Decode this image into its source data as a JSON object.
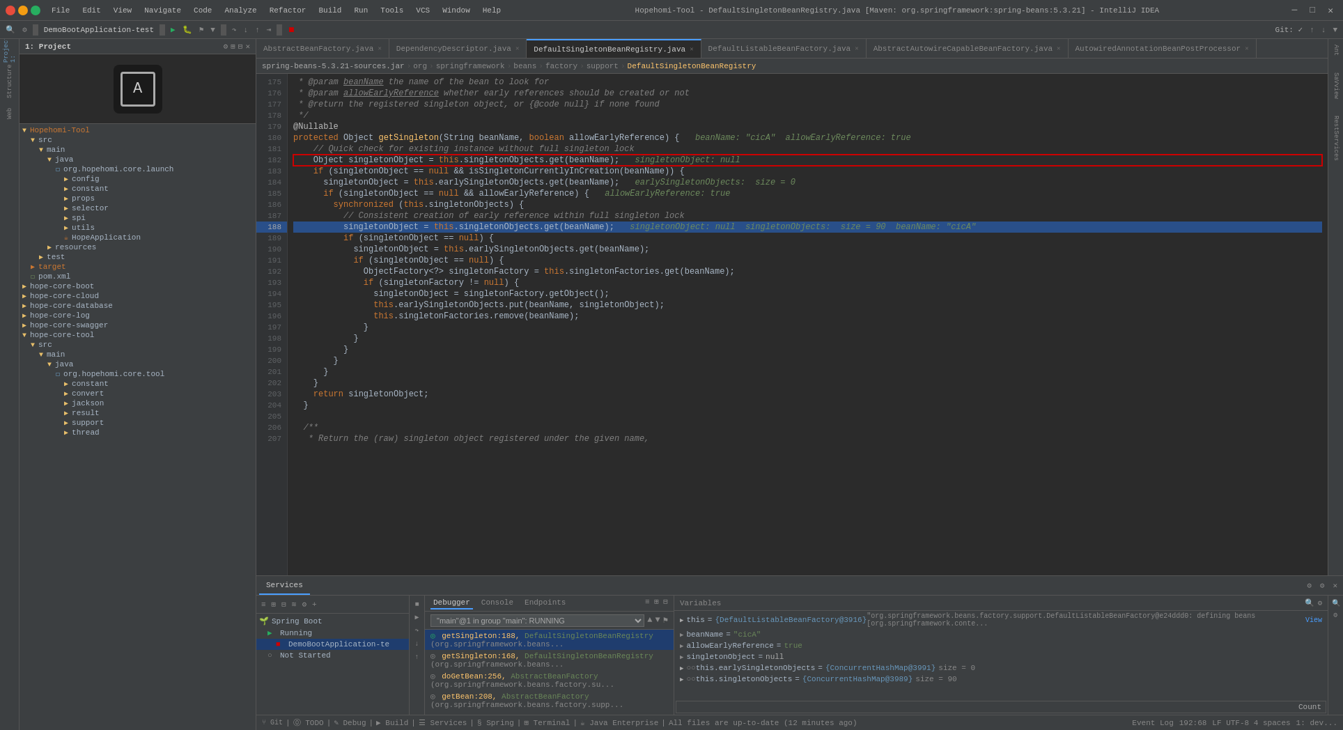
{
  "titlebar": {
    "menu": [
      "File",
      "Edit",
      "View",
      "Navigate",
      "Code",
      "Analyze",
      "Refactor",
      "Build",
      "Run",
      "Tools",
      "VCS",
      "Window",
      "Help"
    ],
    "title": "Hopehomi-Tool - DefaultSingletonBeanRegistry.java [Maven: org.springframework:spring-beans:5.3.21] - IntelliJ IDEA"
  },
  "breadcrumb": {
    "items": [
      "spring-beans-5.3.21-sources.jar",
      "org",
      "springframework",
      "beans",
      "factory",
      "support",
      "DefaultSingletonBeanRegistry"
    ]
  },
  "tabs": [
    {
      "label": "AbstractBeanFactory.java",
      "active": false
    },
    {
      "label": "DependencyDescriptor.java",
      "active": false
    },
    {
      "label": "DefaultSingletonBeanRegistry.java",
      "active": true
    },
    {
      "label": "DefaultListableBeanFactory.java",
      "active": false
    },
    {
      "label": "AbstractAutowireCapableBeanFactory.java",
      "active": false
    },
    {
      "label": "AutowiredAnnotationBeanPostProcessor",
      "active": false
    }
  ],
  "project": {
    "title": "1: Project",
    "tree": [
      {
        "indent": 0,
        "type": "folder",
        "label": "src",
        "expanded": true
      },
      {
        "indent": 1,
        "type": "folder",
        "label": "main",
        "expanded": true
      },
      {
        "indent": 2,
        "type": "folder",
        "label": "java",
        "expanded": true
      },
      {
        "indent": 3,
        "type": "package",
        "label": "org.hopehomi.core.launch",
        "expanded": true
      },
      {
        "indent": 4,
        "type": "folder",
        "label": "config",
        "expanded": false
      },
      {
        "indent": 4,
        "type": "folder",
        "label": "constant",
        "expanded": false
      },
      {
        "indent": 4,
        "type": "folder",
        "label": "props",
        "expanded": false
      },
      {
        "indent": 4,
        "type": "folder",
        "label": "selector",
        "expanded": false
      },
      {
        "indent": 4,
        "type": "folder",
        "label": "spi",
        "expanded": false
      },
      {
        "indent": 4,
        "type": "folder",
        "label": "utils",
        "expanded": false
      },
      {
        "indent": 4,
        "type": "java",
        "label": "HopeApplication",
        "expanded": false
      },
      {
        "indent": 2,
        "type": "folder",
        "label": "resources",
        "expanded": false
      },
      {
        "indent": 1,
        "type": "folder",
        "label": "test",
        "expanded": false
      },
      {
        "indent": 0,
        "type": "folder_yellow",
        "label": "target",
        "expanded": false
      },
      {
        "indent": 0,
        "type": "xml",
        "label": "pom.xml",
        "expanded": false
      },
      {
        "indent": 0,
        "type": "folder",
        "label": "hope-core-boot",
        "expanded": false
      },
      {
        "indent": 0,
        "type": "folder",
        "label": "hope-core-cloud",
        "expanded": false
      },
      {
        "indent": 0,
        "type": "folder",
        "label": "hope-core-database",
        "expanded": false
      },
      {
        "indent": 0,
        "type": "folder",
        "label": "hope-core-log",
        "expanded": false
      },
      {
        "indent": 0,
        "type": "folder",
        "label": "hope-core-swagger",
        "expanded": false
      },
      {
        "indent": 0,
        "type": "folder",
        "label": "hope-core-tool",
        "expanded": true
      },
      {
        "indent": 1,
        "type": "folder",
        "label": "src",
        "expanded": true
      },
      {
        "indent": 2,
        "type": "folder",
        "label": "main",
        "expanded": true
      },
      {
        "indent": 3,
        "type": "folder",
        "label": "java",
        "expanded": true
      },
      {
        "indent": 4,
        "type": "package",
        "label": "org.hopehomi.core.tool",
        "expanded": true
      },
      {
        "indent": 5,
        "type": "folder",
        "label": "constant",
        "expanded": false
      },
      {
        "indent": 5,
        "type": "folder",
        "label": "convert",
        "expanded": false
      },
      {
        "indent": 5,
        "type": "folder",
        "label": "jackson",
        "expanded": false
      },
      {
        "indent": 5,
        "type": "folder",
        "label": "result",
        "expanded": false
      },
      {
        "indent": 5,
        "type": "folder",
        "label": "support",
        "expanded": false
      },
      {
        "indent": 5,
        "type": "folder",
        "label": "thread",
        "expanded": false
      }
    ]
  },
  "code": {
    "lines": [
      {
        "num": 175,
        "content": " * @param beanName the name of the bean to look for",
        "type": "comment"
      },
      {
        "num": 176,
        "content": " * @param allowEarlyReference whether early references should be created or not",
        "type": "comment"
      },
      {
        "num": 177,
        "content": " * @return the registered singleton object, or {@code null} if none found",
        "type": "comment"
      },
      {
        "num": 178,
        "content": " */",
        "type": "comment"
      },
      {
        "num": 179,
        "content": "@Nullable",
        "type": "annotation"
      },
      {
        "num": 180,
        "content": "protected Object getSingleton(String beanName, boolean allowEarlyReference) {  beanName: \"cicA\"  allowEarlyReference: true",
        "type": "normal"
      },
      {
        "num": 181,
        "content": "  // Quick check for existing instance without full singleton lock",
        "type": "comment"
      },
      {
        "num": 182,
        "content": "  Object singletonObject = this.singletonObjects.get(beanName);  singletonObject: null",
        "type": "outline"
      },
      {
        "num": 183,
        "content": "  if (singletonObject == null && isSingletonCurrentlyInCreation(beanName)) {",
        "type": "normal"
      },
      {
        "num": 184,
        "content": "    singletonObject = this.earlySingletonObjects.get(beanName);  earlySingletonObjects:  size = 0",
        "type": "normal"
      },
      {
        "num": 185,
        "content": "    if (singletonObject == null && allowEarlyReference) {  allowEarlyReference: true",
        "type": "normal"
      },
      {
        "num": 186,
        "content": "      synchronized (this.singletonObjects) {",
        "type": "normal"
      },
      {
        "num": 187,
        "content": "        // Consistent creation of early reference within full singleton lock",
        "type": "comment"
      },
      {
        "num": 188,
        "content": "        singletonObject = this.singletonObjects.get(beanName);  singletonObject: null  singletonObjects:  size = 90  beanName: \"cicA\"",
        "type": "highlighted"
      },
      {
        "num": 189,
        "content": "        if (singletonObject == null) {",
        "type": "normal"
      },
      {
        "num": 190,
        "content": "          singletonObject = this.earlySingletonObjects.get(beanName);",
        "type": "normal"
      },
      {
        "num": 191,
        "content": "          if (singletonObject == null) {",
        "type": "normal"
      },
      {
        "num": 192,
        "content": "            ObjectFactory<?> singletonFactory = this.singletonFactories.get(beanName);",
        "type": "normal"
      },
      {
        "num": 193,
        "content": "            if (singletonFactory != null) {",
        "type": "normal"
      },
      {
        "num": 194,
        "content": "              singletonObject = singletonFactory.getObject();",
        "type": "normal"
      },
      {
        "num": 195,
        "content": "              this.earlySingletonObjects.put(beanName, singletonObject);",
        "type": "normal"
      },
      {
        "num": 196,
        "content": "              this.singletonFactories.remove(beanName);",
        "type": "normal"
      },
      {
        "num": 197,
        "content": "            }",
        "type": "normal"
      },
      {
        "num": 198,
        "content": "          }",
        "type": "normal"
      },
      {
        "num": 199,
        "content": "        }",
        "type": "normal"
      },
      {
        "num": 200,
        "content": "      }",
        "type": "normal"
      },
      {
        "num": 201,
        "content": "    }",
        "type": "normal"
      },
      {
        "num": 202,
        "content": "  }",
        "type": "normal"
      },
      {
        "num": 203,
        "content": "  return singletonObject;",
        "type": "normal"
      },
      {
        "num": 204,
        "content": "}",
        "type": "normal"
      },
      {
        "num": 205,
        "content": "",
        "type": "normal"
      },
      {
        "num": 206,
        "content": "/**",
        "type": "comment"
      },
      {
        "num": 207,
        "content": " * Return the (raw) singleton object registered under the given name,",
        "type": "comment"
      }
    ]
  },
  "services": {
    "title": "Services",
    "toolbar_icons": [
      "≡",
      "⊞",
      "⊟",
      "≋",
      "⚙",
      "+"
    ],
    "items": [
      {
        "type": "spring",
        "label": "Spring Boot",
        "expanded": true
      },
      {
        "type": "running",
        "label": "Running",
        "expanded": true,
        "indent": 1
      },
      {
        "type": "app",
        "label": "DemoBootApplication-te",
        "expanded": false,
        "indent": 2
      },
      {
        "type": "stopped",
        "label": "Not Started",
        "expanded": false,
        "indent": 1
      }
    ]
  },
  "debugger": {
    "tabs": [
      "Debugger",
      "Console",
      "Endpoints"
    ],
    "thread_value": "\"main\"@1 in group \"main\": RUNNING",
    "frames": [
      {
        "method": "getSingleton:188",
        "class": "DefaultSingletonBeanRegistry",
        "extra": "(org.springframework.beans...",
        "selected": true
      },
      {
        "method": "getSingleton:168",
        "class": "DefaultSingletonBeanRegistry",
        "extra": "(org.springframework.beans...",
        "selected": false
      },
      {
        "method": "doGetBean:256",
        "class": "AbstractBeanFactory",
        "extra": "(org.springframework.beans.factory.su...",
        "selected": false
      },
      {
        "method": "getBean:208",
        "class": "AbstractBeanFactory",
        "extra": "(org.springframework.beans.factory.supp...",
        "selected": false
      }
    ]
  },
  "variables": {
    "header": "Variables",
    "items": [
      {
        "indent": 0,
        "name": "this",
        "eq": "=",
        "value": "{DefaultListableBeanFactory@3916}",
        "extra": "\"org.springframework.beans.factory.support.DefaultListableBeanFactory@e24ddd0: defining beans [org.springframework.conte...",
        "type": "obj",
        "expanded": false
      },
      {
        "indent": 0,
        "name": "beanName",
        "eq": "=",
        "value": "\"cicA\"",
        "type": "str",
        "expanded": false
      },
      {
        "indent": 0,
        "name": "allowEarlyReference",
        "eq": "=",
        "value": "true",
        "type": "bool",
        "expanded": false
      },
      {
        "indent": 0,
        "name": "singletonObject",
        "eq": "=",
        "value": "null",
        "type": "null",
        "expanded": false
      },
      {
        "indent": 0,
        "name": "○○ this.earlySingletonObjects",
        "eq": "=",
        "value": "{ConcurrentHashMap@3991}",
        "extra": "size = 0",
        "type": "obj",
        "expanded": false
      },
      {
        "indent": 0,
        "name": "○○ this.singletonObjects",
        "eq": "=",
        "value": "{ConcurrentHashMap@3989}",
        "extra": "size = 90",
        "type": "obj",
        "expanded": false
      }
    ],
    "count": "Count"
  },
  "statusbar": {
    "message": "All files are up-to-date (12 minutes ago)",
    "icons": [
      "⑂ Git",
      "⓪ TODO",
      "✎ Debug",
      "▶ Build",
      "☰ Services",
      "§ Spring",
      "⊞ Terminal",
      "☕ Java Enterprise"
    ],
    "position": "192:68",
    "encoding": "LF  UTF-8  4 spaces",
    "devtools": "1: dev..."
  },
  "run_config": {
    "label": "DemoBootApplication-test",
    "run_icon": "▶",
    "stop_icon": "⏹",
    "debug_icon": "🐛"
  }
}
